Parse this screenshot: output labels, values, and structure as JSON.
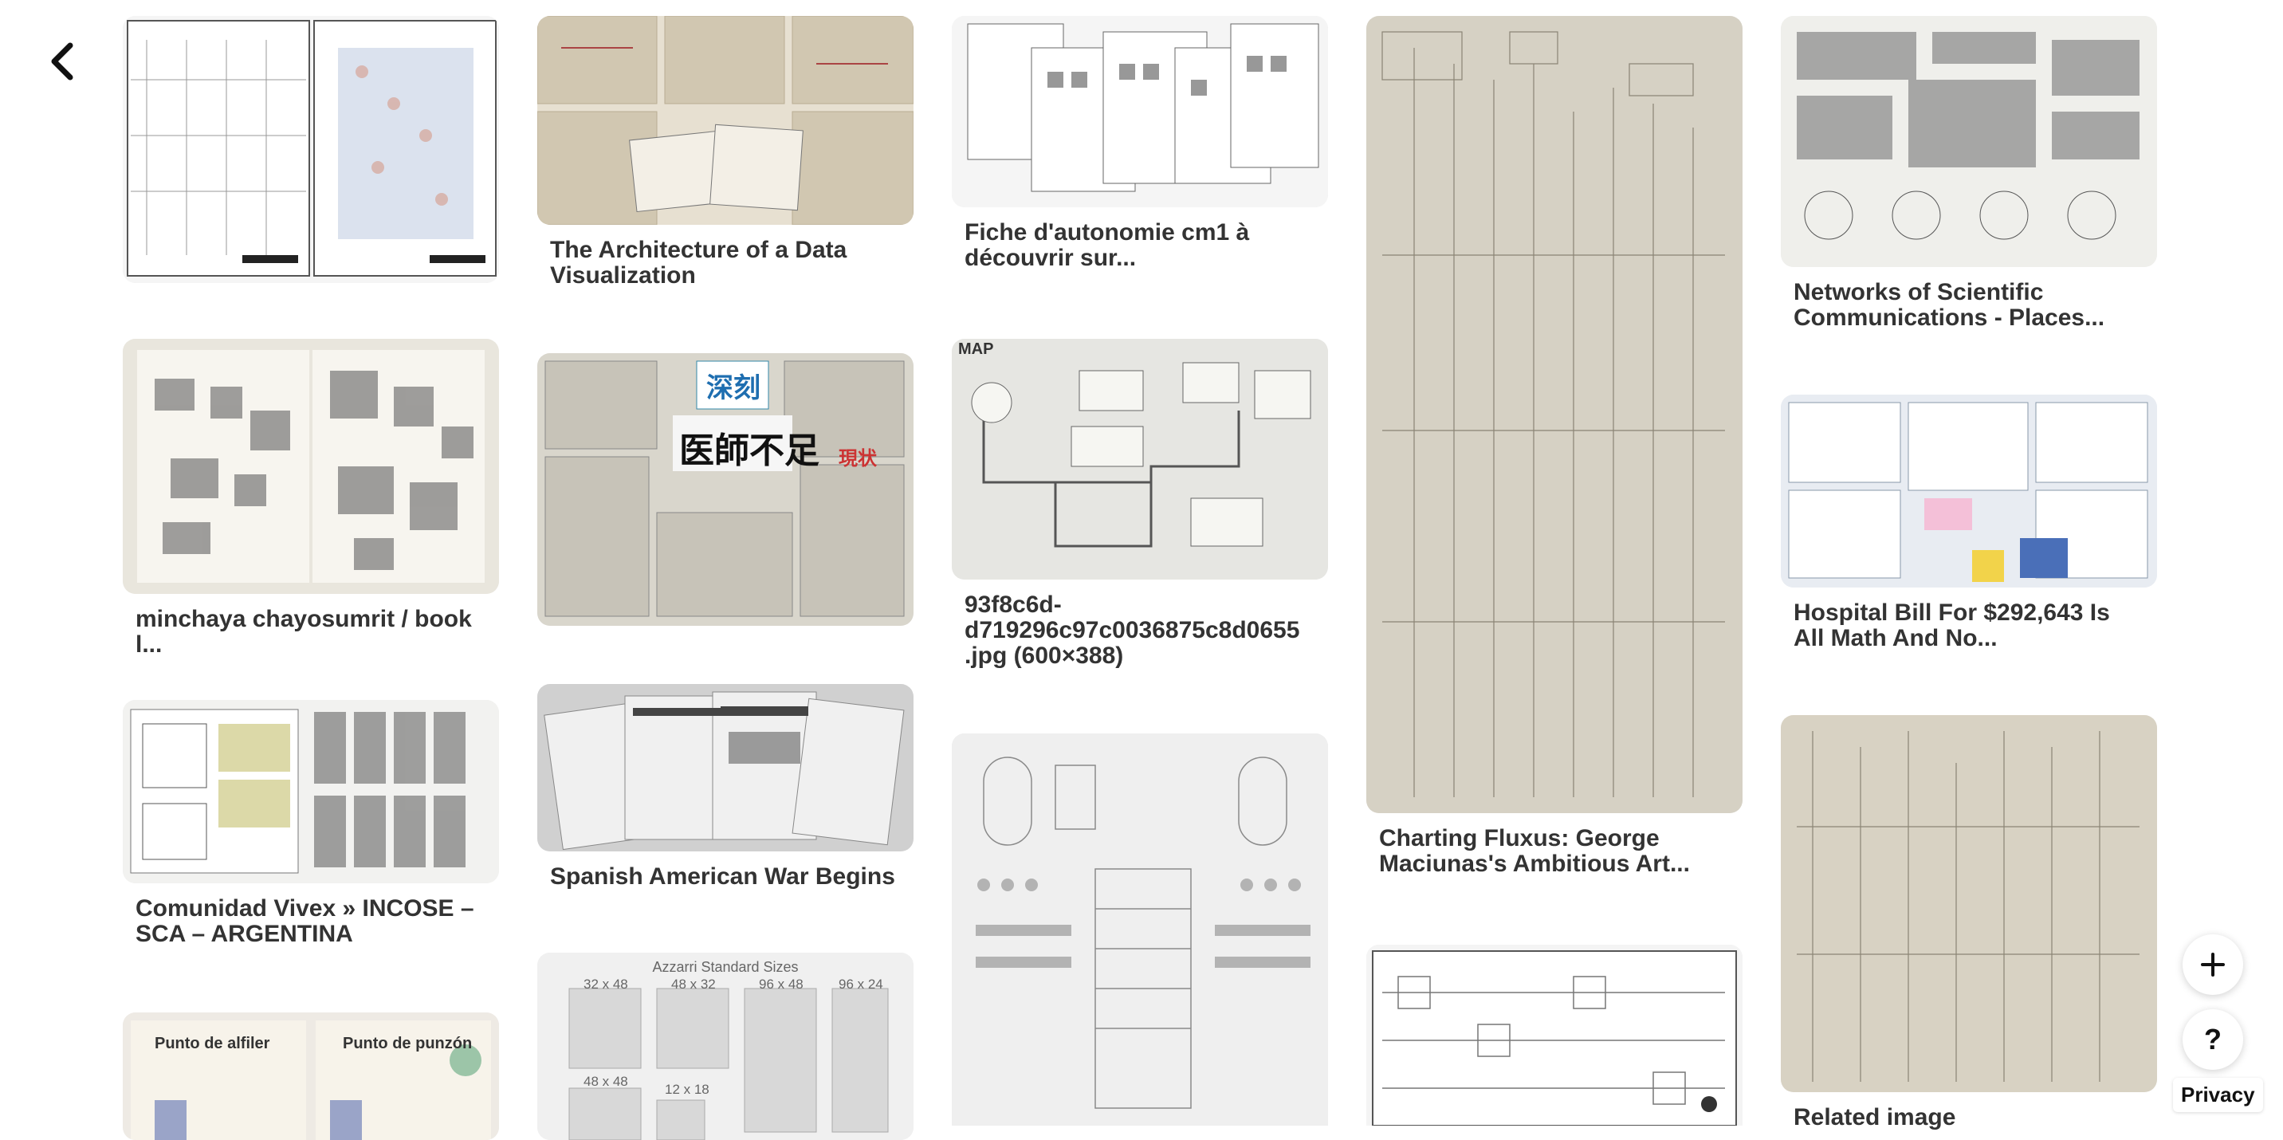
{
  "nav": {
    "back_icon": "chevron-left-icon"
  },
  "pins": [
    {
      "id": "p1",
      "title": "",
      "bg": "#f3f3f3",
      "style": "blueprint"
    },
    {
      "id": "p2",
      "title": "The Architecture of a Data Visualization",
      "bg": "#e9e3d6",
      "style": "sheets"
    },
    {
      "id": "p3",
      "title": "Fiche d'autonomie cm1 à décou­vrir sur...",
      "bg": "#f4f4f4",
      "style": "worksheets"
    },
    {
      "id": "p4",
      "title": "Charting Fluxus: George Maciu­nas's Ambitious Art...",
      "bg": "#d6d1c4",
      "style": "tree"
    },
    {
      "id": "p5",
      "title": "Networks of Scientific Commu­nications - Places...",
      "bg": "#eeeeea",
      "style": "network"
    },
    {
      "id": "p6",
      "title": "minchaya chayosumrit / book l...",
      "bg": "#e6e4dc",
      "style": "book"
    },
    {
      "id": "p7",
      "title": "",
      "bg": "#d9d6cc",
      "style": "collage"
    },
    {
      "id": "p8",
      "title": "93f8c6d-d719296c97c0036875c8d0655 .jpg (600×388)",
      "bg": "#e4e4e0",
      "style": "map"
    },
    {
      "id": "p9",
      "title": "Hospital Bill For $292,643 Is All Math And No...",
      "bg": "#e8ecf2",
      "style": "bill"
    },
    {
      "id": "p10",
      "title": "Spanish American War Begins",
      "bg": "#cfcfcf",
      "style": "news"
    },
    {
      "id": "p11",
      "title": "Comunidad Vivex » INCOSE – SCA – ARGENTINA",
      "bg": "#eeeeec",
      "style": "plans"
    },
    {
      "id": "p12",
      "title": "",
      "bg": "#ececec",
      "style": "ornaments"
    },
    {
      "id": "p13",
      "title": "Related image",
      "bg": "#d8d2c3",
      "style": "tree"
    },
    {
      "id": "p14",
      "title": "",
      "bg": "#f2f2f2",
      "style": "circuit"
    },
    {
      "id": "p15",
      "title": "",
      "bg": "#eeeae4",
      "style": "stitch"
    },
    {
      "id": "p16",
      "title": "",
      "bg": "#eaeaea",
      "style": "tiles"
    }
  ],
  "p15_header": {
    "left": "Punto de alfiler",
    "right": "Punto de punzón"
  },
  "p16_header": {
    "title": "Azzarri Standard Sizes",
    "sizes": [
      "32 x 48",
      "48 x 32",
      "96 x 48",
      "96 x 24",
      "48 x 48",
      "12 x 18"
    ]
  },
  "p7_labels": {
    "big": "深刻",
    "sub": "医師不足",
    "side": "現状"
  },
  "p8_label": "MAP",
  "fab": {
    "plus": "+",
    "help": "?"
  },
  "privacy_label": "Privacy"
}
